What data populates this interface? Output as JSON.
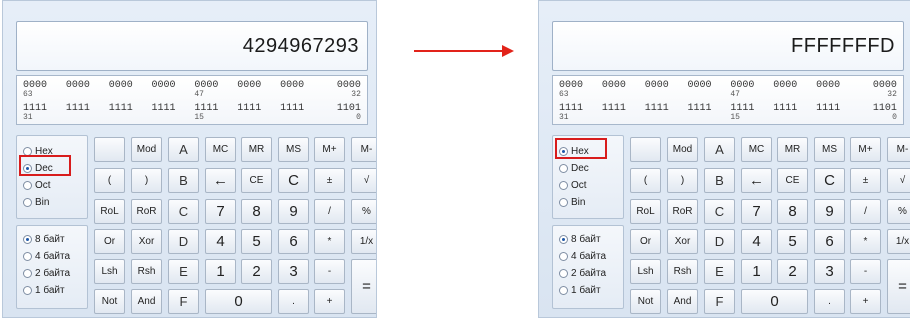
{
  "left": {
    "display": "4294967293",
    "selected_base": "Dec",
    "highlighted": "Dec"
  },
  "right": {
    "display": "FFFFFFFD",
    "selected_base": "Hex",
    "highlighted": "Hex"
  },
  "bits": {
    "row1": [
      "0000",
      "0000",
      "0000",
      "0000",
      "0000",
      "0000",
      "0000",
      "0000"
    ],
    "row1_idx": [
      "63",
      "",
      "",
      "",
      "47",
      "",
      "",
      "32"
    ],
    "row2": [
      "1111",
      "1111",
      "1111",
      "1111",
      "1111",
      "1111",
      "1111",
      "1101"
    ],
    "row2_idx": [
      "31",
      "",
      "",
      "",
      "15",
      "",
      "",
      "0"
    ]
  },
  "bases": [
    "Hex",
    "Dec",
    "Oct",
    "Bin"
  ],
  "sizes": [
    "8 байт",
    "4 байта",
    "2 байта",
    "1 байт"
  ],
  "selected_size": "8 байт",
  "buttons": [
    [
      "",
      "Mod",
      "A",
      "MC",
      "MR",
      "MS",
      "M+",
      "M-"
    ],
    [
      "(",
      ")",
      "B",
      "←",
      "CE",
      "C",
      "±",
      "√"
    ],
    [
      "RoL",
      "RoR",
      "C",
      "7",
      "8",
      "9",
      "/",
      "%"
    ],
    [
      "Or",
      "Xor",
      "D",
      "4",
      "5",
      "6",
      "*",
      "1/x"
    ],
    [
      "Lsh",
      "Rsh",
      "E",
      "1",
      "2",
      "3",
      "-",
      "="
    ],
    [
      "Not",
      "And",
      "F",
      "0",
      ".",
      "+"
    ]
  ],
  "colors": {
    "arrow": "#e2231a",
    "highlight": "#d81c1c"
  }
}
